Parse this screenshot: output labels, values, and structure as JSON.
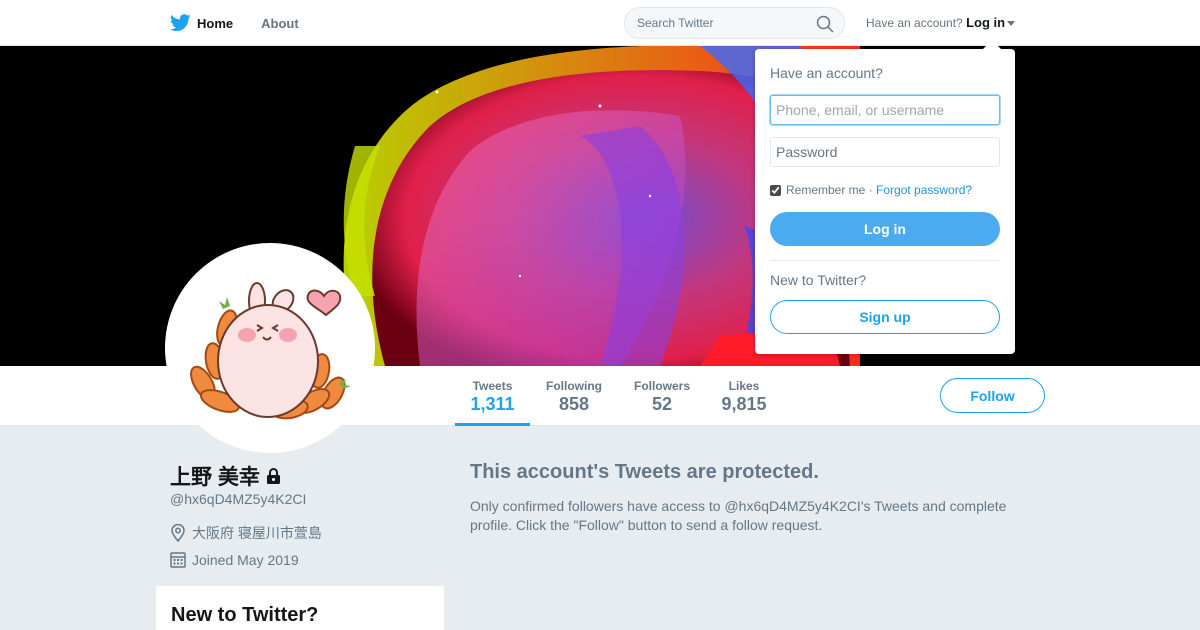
{
  "colors": {
    "accent": "#1da1f2",
    "login_button": "#4aabf0",
    "page_background": "#e6ecf0",
    "muted_text": "#657786"
  },
  "nav": {
    "logo_icon": "twitter-bird-icon",
    "home_label": "Home",
    "about_label": "About",
    "search_placeholder": "Search Twitter",
    "search_icon": "magnifier-icon",
    "have_account_text": "Have an account?",
    "login_label": "Log in"
  },
  "profile": {
    "name": "上野 美幸",
    "protected_icon": "lock-icon",
    "handle": "@hx6qD4MZ5y4K2CI",
    "location": "大阪府 寝屋川市萱島",
    "location_icon": "map-pin-icon",
    "joined": "Joined May 2019",
    "joined_icon": "calendar-icon"
  },
  "stats": {
    "tweets": {
      "label": "Tweets",
      "value": "1,311"
    },
    "following": {
      "label": "Following",
      "value": "858"
    },
    "followers": {
      "label": "Followers",
      "value": "52"
    },
    "likes": {
      "label": "Likes",
      "value": "9,815"
    }
  },
  "follow_label": "Follow",
  "protected": {
    "title": "This account's Tweets are protected.",
    "text": "Only confirmed followers have access to @hx6qD4MZ5y4K2CI's Tweets and complete profile. Click the \"Follow\" button to send a follow request."
  },
  "sidebar": {
    "new_title": "New to Twitter?"
  },
  "login_dropdown": {
    "heading": "Have an account?",
    "username_placeholder": "Phone, email, or username",
    "password_placeholder": "Password",
    "remember_label": "Remember me",
    "separator": " · ",
    "forgot_label": "Forgot password?",
    "login_button": "Log in",
    "new_to_twitter": "New to Twitter?",
    "signup_button": "Sign up"
  }
}
